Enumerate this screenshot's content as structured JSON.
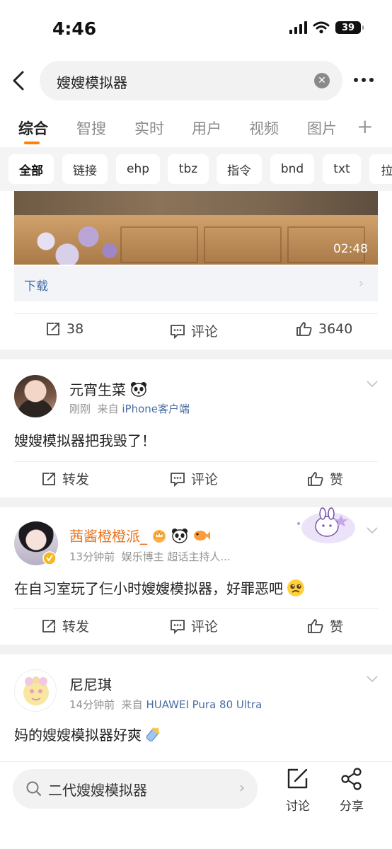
{
  "status_bar": {
    "time": "4:46",
    "battery": "39"
  },
  "search": {
    "query": "嫂嫂模拟器"
  },
  "tabs": [
    {
      "label": "综合"
    },
    {
      "label": "智搜"
    },
    {
      "label": "实时"
    },
    {
      "label": "用户"
    },
    {
      "label": "视频"
    },
    {
      "label": "图片"
    }
  ],
  "tabs_add": "+",
  "chips": [
    {
      "label": "全部"
    },
    {
      "label": "链接"
    },
    {
      "label": "ehp"
    },
    {
      "label": "tbz"
    },
    {
      "label": "指令"
    },
    {
      "label": "bnd"
    },
    {
      "label": "txt"
    },
    {
      "label": "拉"
    }
  ],
  "video": {
    "duration": "02:48",
    "download_label": "下载",
    "actions": {
      "repost": "38",
      "comment": "评论",
      "like": "3640"
    }
  },
  "posts": [
    {
      "name": "元宵生菜",
      "time": "刚刚",
      "source_prefix": "来自",
      "source": "iPhone客户端",
      "text": "嫂嫂模拟器把我毁了！",
      "actions": {
        "repost": "转发",
        "comment": "评论",
        "like": "赞"
      }
    },
    {
      "name": "茜酱橙橙派_",
      "time": "13分钟前",
      "tags": "娱乐博主 超话主持人...",
      "text": "在自习室玩了仨小时嫂嫂模拟器，好罪恶吧",
      "actions": {
        "repost": "转发",
        "comment": "评论",
        "like": "赞"
      }
    },
    {
      "name": "尼尼琪",
      "time": "14分钟前",
      "source_prefix": "来自",
      "source": "HUAWEI Pura 80 Ultra",
      "text": "妈的嫂嫂模拟器好爽"
    }
  ],
  "bottom_bar": {
    "search_text": "二代嫂嫂模拟器",
    "discuss": "讨论",
    "share": "分享"
  },
  "colors": {
    "accent": "#ff8200",
    "vip_name": "#e8741f",
    "link_blue": "#4a6ea3",
    "muted": "#939393"
  }
}
